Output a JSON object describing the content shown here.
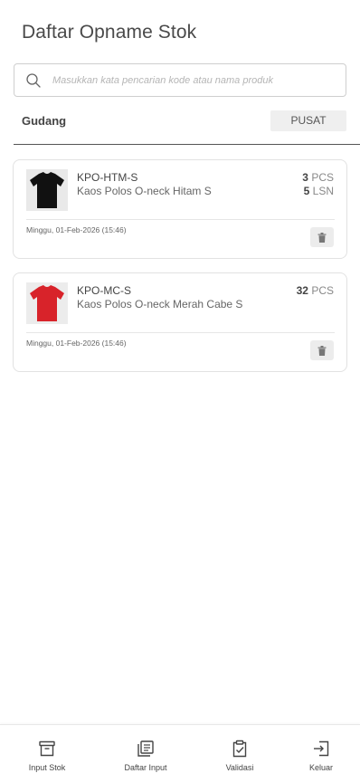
{
  "header": {
    "title": "Daftar Opname Stok"
  },
  "search": {
    "placeholder": "Masukkan kata pencarian kode atau nama produk"
  },
  "warehouse": {
    "label": "Gudang",
    "value": "PUSAT"
  },
  "items": [
    {
      "code": "KPO-HTM-S",
      "name": "Kaos Polos O-neck Hitam S",
      "quantities": [
        {
          "amount": "3",
          "unit": "PCS"
        },
        {
          "amount": "5",
          "unit": "LSN"
        }
      ],
      "date": "Minggu, 01-Feb-2026 (15:46)",
      "shirt_color": "#111111"
    },
    {
      "code": "KPO-MC-S",
      "name": "Kaos Polos O-neck Merah Cabe S",
      "quantities": [
        {
          "amount": "32",
          "unit": "PCS"
        }
      ],
      "date": "Minggu, 01-Feb-2026 (15:46)",
      "shirt_color": "#d8232a"
    }
  ],
  "nav": {
    "input_stok": "Input Stok",
    "daftar_input": "Daftar Input",
    "validasi": "Validasi",
    "keluar": "Keluar"
  }
}
